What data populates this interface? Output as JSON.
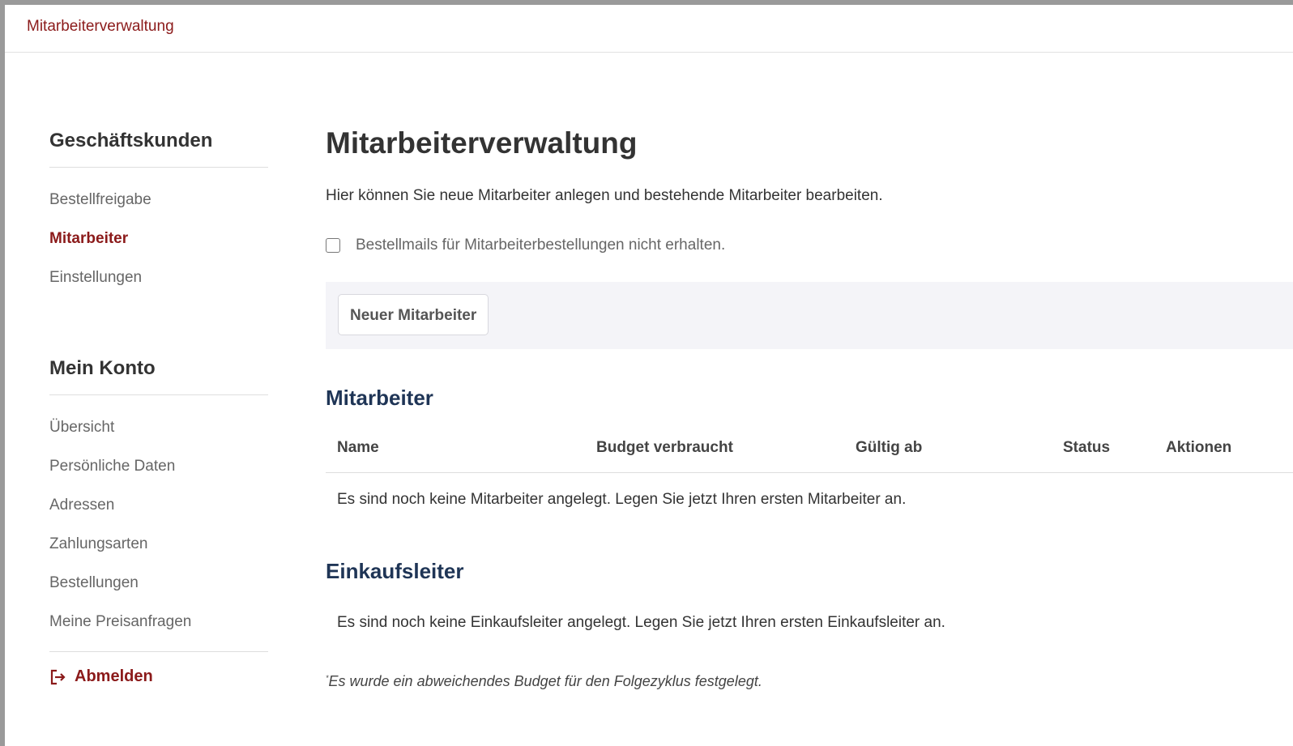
{
  "breadcrumb": {
    "current": "Mitarbeiterverwaltung"
  },
  "sidebar": {
    "section1": {
      "heading": "Geschäftskunden",
      "items": [
        {
          "label": "Bestellfreigabe",
          "active": false
        },
        {
          "label": "Mitarbeiter",
          "active": true
        },
        {
          "label": "Einstellungen",
          "active": false
        }
      ]
    },
    "section2": {
      "heading": "Mein Konto",
      "items": [
        {
          "label": "Übersicht"
        },
        {
          "label": "Persönliche Daten"
        },
        {
          "label": "Adressen"
        },
        {
          "label": "Zahlungsarten"
        },
        {
          "label": "Bestellungen"
        },
        {
          "label": "Meine Preisanfragen"
        }
      ]
    },
    "logout_label": "Abmelden",
    "logout_icon": "logout-icon"
  },
  "main": {
    "title": "Mitarbeiterverwaltung",
    "intro": "Hier können Sie neue Mitarbeiter anlegen und bestehende Mitarbeiter bearbeiten.",
    "checkbox": {
      "label": "Bestellmails für Mitarbeiterbestellungen nicht erhalten.",
      "checked": false
    },
    "new_button_label": "Neuer Mitarbeiter",
    "employees": {
      "title": "Mitarbeiter",
      "columns": [
        "Name",
        "Budget verbraucht",
        "Gültig ab",
        "Status",
        "Aktionen"
      ],
      "empty_message": "Es sind noch keine Mitarbeiter angelegt. Legen Sie jetzt Ihren ersten Mitarbeiter an."
    },
    "purchasing_managers": {
      "title": "Einkaufsleiter",
      "empty_message": "Es sind noch keine Einkaufsleiter angelegt. Legen Sie jetzt Ihren ersten Einkaufsleiter an."
    },
    "footnote_marker": "*",
    "footnote": "Es wurde ein abweichendes Budget für den Folgezyklus festgelegt."
  },
  "colors": {
    "accent": "#8b1a1a",
    "section_heading": "#1f3556",
    "action_bar_bg": "#f4f4f8"
  }
}
